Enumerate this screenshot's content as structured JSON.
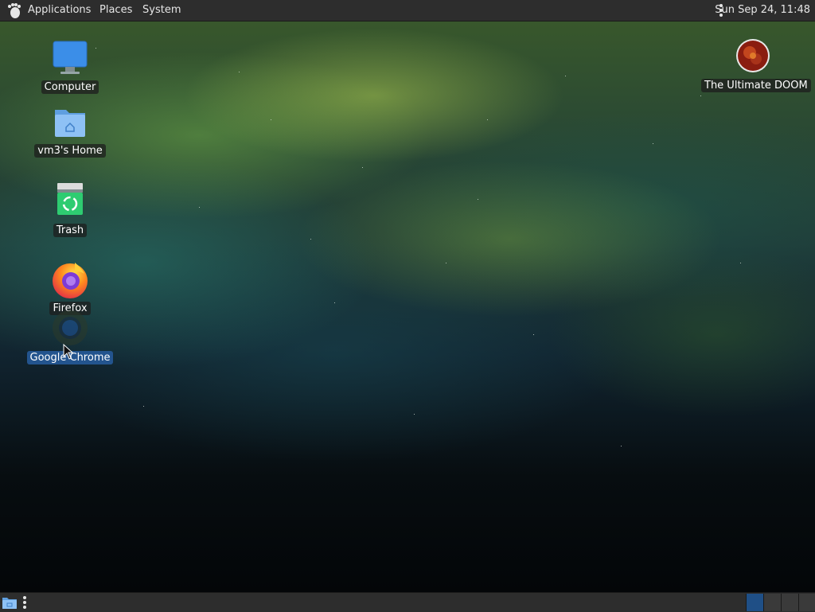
{
  "top_panel": {
    "menus": [
      "Applications",
      "Places",
      "System"
    ],
    "clock": "Sun Sep 24, 11:48"
  },
  "desktop": {
    "icons": [
      {
        "label": "Computer",
        "icon": "computer-icon"
      },
      {
        "label": "vm3's Home",
        "icon": "home-folder-icon"
      },
      {
        "label": "Trash",
        "icon": "trash-icon"
      },
      {
        "label": "Firefox",
        "icon": "firefox-icon"
      },
      {
        "label": "Google Chrome",
        "icon": "chrome-icon",
        "selected": true
      },
      {
        "label": "The Ultimate DOOM",
        "icon": "doom-icon"
      }
    ]
  },
  "bottom_panel": {
    "workspaces": 4,
    "active_workspace": 1
  },
  "colors": {
    "panel_bg": "#2d2d2d",
    "selection": "#23548e",
    "label_bg": "rgba(30,30,30,0.75)"
  }
}
